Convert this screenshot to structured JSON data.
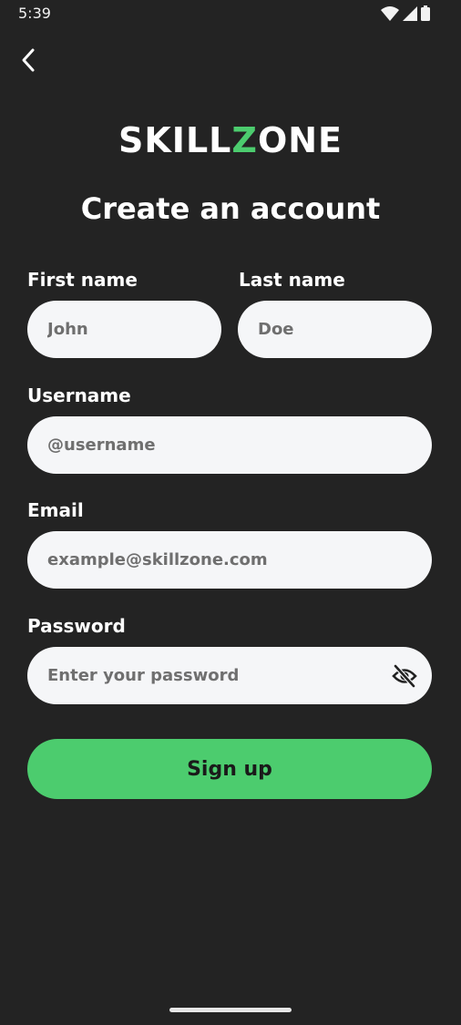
{
  "status_bar": {
    "time": "5:39",
    "icons": [
      "wifi-icon",
      "signal-icon",
      "battery-icon"
    ]
  },
  "nav": {
    "back_icon": "chevron-left-icon"
  },
  "logo": {
    "part1": "SKILL",
    "accent": "Z",
    "part2": "ONE",
    "accent_color": "#4ccc6e"
  },
  "title": "Create an account",
  "form": {
    "first_name": {
      "label": "First name",
      "placeholder": "John"
    },
    "last_name": {
      "label": "Last name",
      "placeholder": "Doe"
    },
    "username": {
      "label": "Username",
      "placeholder": "@username"
    },
    "email": {
      "label": "Email",
      "placeholder": "example@skillzone.com"
    },
    "password": {
      "label": "Password",
      "placeholder": "Enter your password",
      "toggle_icon": "eye-off-icon"
    }
  },
  "submit": {
    "label": "Sign up",
    "color": "#4ccc6e"
  },
  "colors": {
    "background": "#232323",
    "field": "#f5f6f8"
  }
}
